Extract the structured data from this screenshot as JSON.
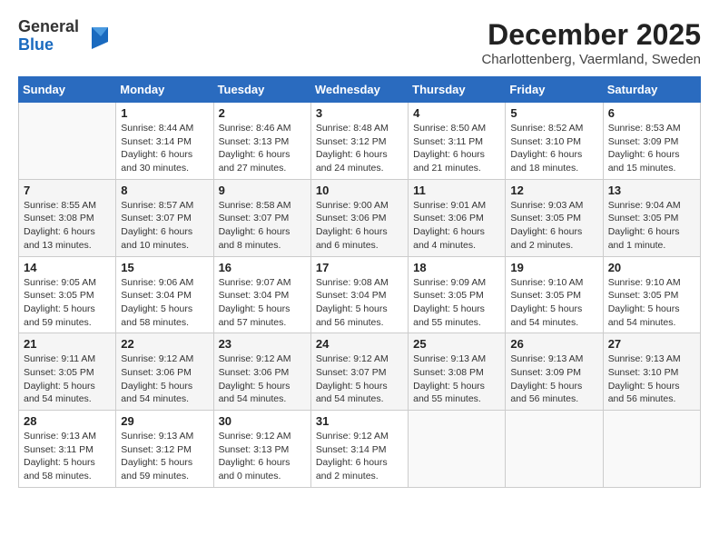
{
  "header": {
    "logo": {
      "line1": "General",
      "line2": "Blue"
    },
    "title": "December 2025",
    "location": "Charlottenberg, Vaermland, Sweden"
  },
  "calendar": {
    "weekdays": [
      "Sunday",
      "Monday",
      "Tuesday",
      "Wednesday",
      "Thursday",
      "Friday",
      "Saturday"
    ],
    "weeks": [
      [
        {
          "day": "",
          "info": ""
        },
        {
          "day": "1",
          "info": "Sunrise: 8:44 AM\nSunset: 3:14 PM\nDaylight: 6 hours\nand 30 minutes."
        },
        {
          "day": "2",
          "info": "Sunrise: 8:46 AM\nSunset: 3:13 PM\nDaylight: 6 hours\nand 27 minutes."
        },
        {
          "day": "3",
          "info": "Sunrise: 8:48 AM\nSunset: 3:12 PM\nDaylight: 6 hours\nand 24 minutes."
        },
        {
          "day": "4",
          "info": "Sunrise: 8:50 AM\nSunset: 3:11 PM\nDaylight: 6 hours\nand 21 minutes."
        },
        {
          "day": "5",
          "info": "Sunrise: 8:52 AM\nSunset: 3:10 PM\nDaylight: 6 hours\nand 18 minutes."
        },
        {
          "day": "6",
          "info": "Sunrise: 8:53 AM\nSunset: 3:09 PM\nDaylight: 6 hours\nand 15 minutes."
        }
      ],
      [
        {
          "day": "7",
          "info": "Sunrise: 8:55 AM\nSunset: 3:08 PM\nDaylight: 6 hours\nand 13 minutes."
        },
        {
          "day": "8",
          "info": "Sunrise: 8:57 AM\nSunset: 3:07 PM\nDaylight: 6 hours\nand 10 minutes."
        },
        {
          "day": "9",
          "info": "Sunrise: 8:58 AM\nSunset: 3:07 PM\nDaylight: 6 hours\nand 8 minutes."
        },
        {
          "day": "10",
          "info": "Sunrise: 9:00 AM\nSunset: 3:06 PM\nDaylight: 6 hours\nand 6 minutes."
        },
        {
          "day": "11",
          "info": "Sunrise: 9:01 AM\nSunset: 3:06 PM\nDaylight: 6 hours\nand 4 minutes."
        },
        {
          "day": "12",
          "info": "Sunrise: 9:03 AM\nSunset: 3:05 PM\nDaylight: 6 hours\nand 2 minutes."
        },
        {
          "day": "13",
          "info": "Sunrise: 9:04 AM\nSunset: 3:05 PM\nDaylight: 6 hours\nand 1 minute."
        }
      ],
      [
        {
          "day": "14",
          "info": "Sunrise: 9:05 AM\nSunset: 3:05 PM\nDaylight: 5 hours\nand 59 minutes."
        },
        {
          "day": "15",
          "info": "Sunrise: 9:06 AM\nSunset: 3:04 PM\nDaylight: 5 hours\nand 58 minutes."
        },
        {
          "day": "16",
          "info": "Sunrise: 9:07 AM\nSunset: 3:04 PM\nDaylight: 5 hours\nand 57 minutes."
        },
        {
          "day": "17",
          "info": "Sunrise: 9:08 AM\nSunset: 3:04 PM\nDaylight: 5 hours\nand 56 minutes."
        },
        {
          "day": "18",
          "info": "Sunrise: 9:09 AM\nSunset: 3:05 PM\nDaylight: 5 hours\nand 55 minutes."
        },
        {
          "day": "19",
          "info": "Sunrise: 9:10 AM\nSunset: 3:05 PM\nDaylight: 5 hours\nand 54 minutes."
        },
        {
          "day": "20",
          "info": "Sunrise: 9:10 AM\nSunset: 3:05 PM\nDaylight: 5 hours\nand 54 minutes."
        }
      ],
      [
        {
          "day": "21",
          "info": "Sunrise: 9:11 AM\nSunset: 3:05 PM\nDaylight: 5 hours\nand 54 minutes."
        },
        {
          "day": "22",
          "info": "Sunrise: 9:12 AM\nSunset: 3:06 PM\nDaylight: 5 hours\nand 54 minutes."
        },
        {
          "day": "23",
          "info": "Sunrise: 9:12 AM\nSunset: 3:06 PM\nDaylight: 5 hours\nand 54 minutes."
        },
        {
          "day": "24",
          "info": "Sunrise: 9:12 AM\nSunset: 3:07 PM\nDaylight: 5 hours\nand 54 minutes."
        },
        {
          "day": "25",
          "info": "Sunrise: 9:13 AM\nSunset: 3:08 PM\nDaylight: 5 hours\nand 55 minutes."
        },
        {
          "day": "26",
          "info": "Sunrise: 9:13 AM\nSunset: 3:09 PM\nDaylight: 5 hours\nand 56 minutes."
        },
        {
          "day": "27",
          "info": "Sunrise: 9:13 AM\nSunset: 3:10 PM\nDaylight: 5 hours\nand 56 minutes."
        }
      ],
      [
        {
          "day": "28",
          "info": "Sunrise: 9:13 AM\nSunset: 3:11 PM\nDaylight: 5 hours\nand 58 minutes."
        },
        {
          "day": "29",
          "info": "Sunrise: 9:13 AM\nSunset: 3:12 PM\nDaylight: 5 hours\nand 59 minutes."
        },
        {
          "day": "30",
          "info": "Sunrise: 9:12 AM\nSunset: 3:13 PM\nDaylight: 6 hours\nand 0 minutes."
        },
        {
          "day": "31",
          "info": "Sunrise: 9:12 AM\nSunset: 3:14 PM\nDaylight: 6 hours\nand 2 minutes."
        },
        {
          "day": "",
          "info": ""
        },
        {
          "day": "",
          "info": ""
        },
        {
          "day": "",
          "info": ""
        }
      ]
    ]
  }
}
